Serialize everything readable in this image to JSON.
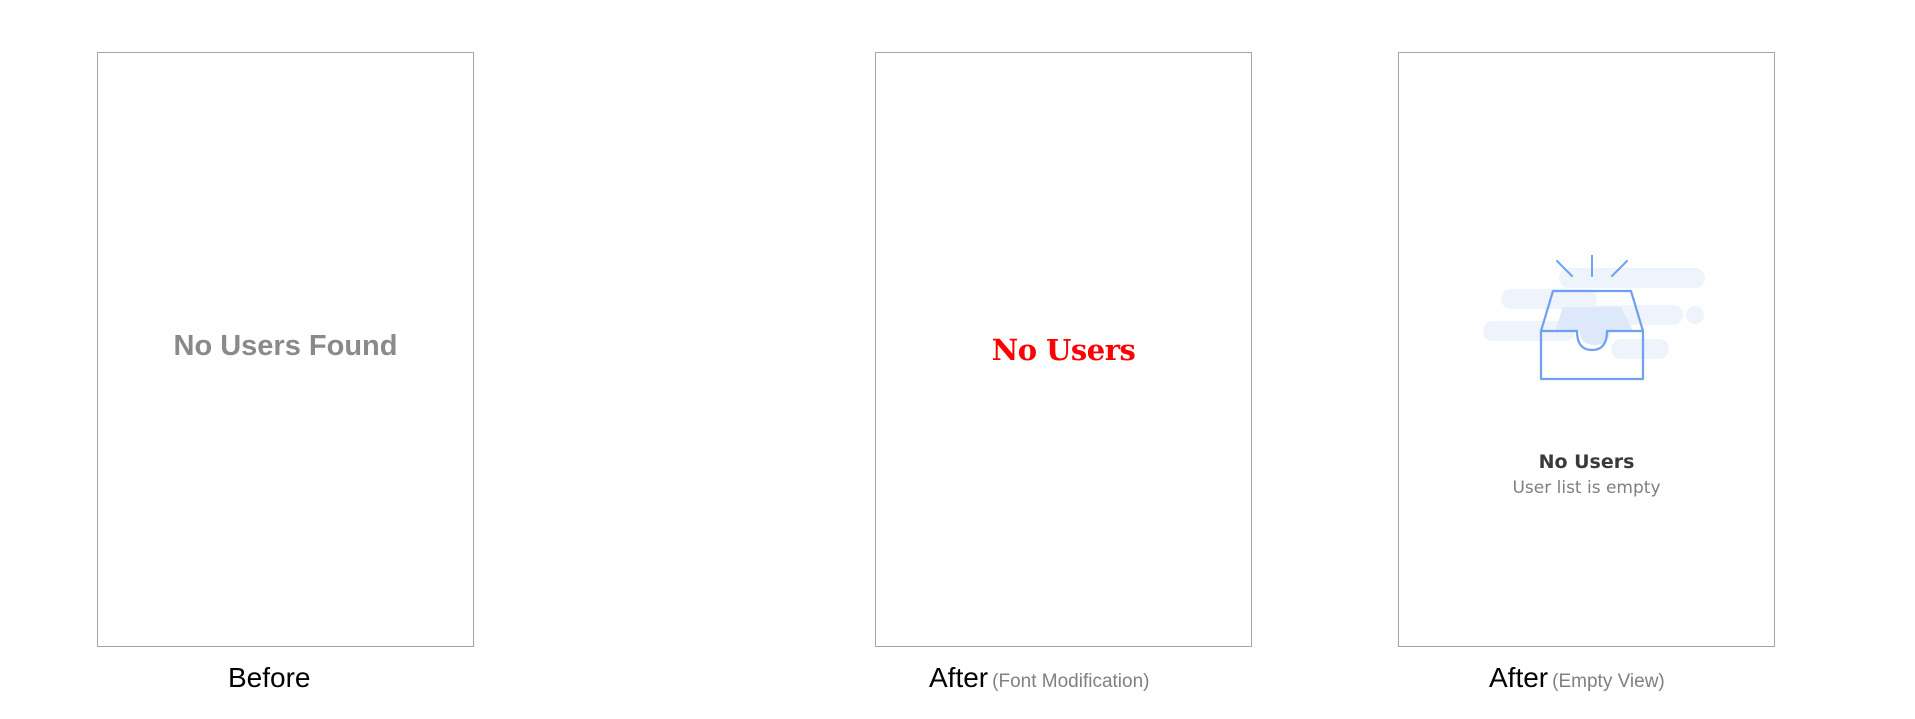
{
  "panels": {
    "before": {
      "message": "No Users Found",
      "caption": "Before"
    },
    "font_modification": {
      "message": "No Users",
      "caption": "After",
      "caption_note": "(Font Modification)"
    },
    "empty_view": {
      "icon": "empty-inbox-icon",
      "title": "No Users",
      "subtitle": "User list is empty",
      "caption": "After",
      "caption_note": "(Empty View)"
    }
  },
  "colors": {
    "frame_border": "#a6a6a6",
    "before_text": "#8a8a8a",
    "font_text": "#ff0000",
    "icon_stroke": "#6ea1f0",
    "icon_fill": "#e6efff",
    "cloud": "#eef3fc"
  }
}
